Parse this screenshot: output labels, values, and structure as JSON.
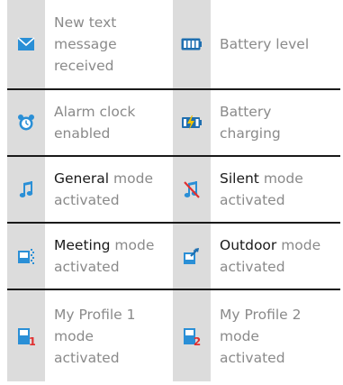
{
  "rows": [
    {
      "left": {
        "icon": "envelope-icon",
        "text": "New text message received"
      },
      "right": {
        "icon": "battery-level-icon",
        "text": "Battery level"
      }
    },
    {
      "left": {
        "icon": "alarm-clock-icon",
        "text": "Alarm clock enabled"
      },
      "right": {
        "icon": "battery-charging-icon",
        "text": "Battery charging"
      }
    },
    {
      "left": {
        "icon": "music-note-icon",
        "mode": "General",
        "suffix": " mode activated"
      },
      "right": {
        "icon": "silent-icon",
        "mode": "Silent",
        "suffix": " mode activated"
      }
    },
    {
      "left": {
        "icon": "meeting-icon",
        "mode": "Meeting",
        "suffix": " mode activated"
      },
      "right": {
        "icon": "outdoor-icon",
        "mode": "Outdoor",
        "suffix": " mode activated"
      }
    },
    {
      "left": {
        "icon": "profile-1-icon",
        "text": "My Profile 1 mode activated"
      },
      "right": {
        "icon": "profile-2-icon",
        "text": "My Profile 2 mode activated"
      }
    }
  ],
  "colors": {
    "icon_bg": "#dcdcdc",
    "separator": "#1a1a1a",
    "text_gray": "#8a8a8a",
    "text_dark": "#1a1a1a",
    "icon_blue": "#2a8fd6"
  }
}
